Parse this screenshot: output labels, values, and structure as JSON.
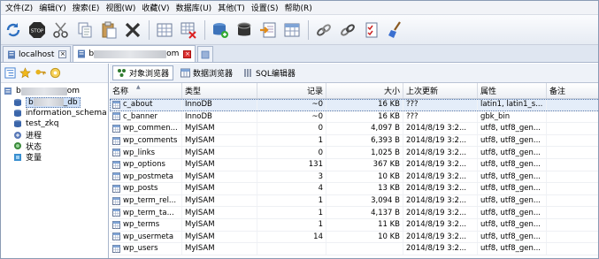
{
  "menu": [
    "文件(Z)",
    "编辑(Y)",
    "搜索(E)",
    "视图(W)",
    "收藏(V)",
    "数据库(U)",
    "其他(T)",
    "设置(S)",
    "帮助(R)"
  ],
  "toolbar_icons": [
    "refresh-icon",
    "stop-icon",
    "cut-icon",
    "copy-icon",
    "paste-icon",
    "delete-icon",
    "grid-icon",
    "grid-delete-icon",
    "database-add-icon",
    "database-icon",
    "import-icon",
    "table-icon",
    "link-icon",
    "link2-icon",
    "checklist-icon",
    "broom-icon"
  ],
  "conn_tabs": [
    {
      "label": "localhost",
      "active": false
    },
    {
      "label_prefix": "b",
      "label_suffix": "om",
      "active": true
    }
  ],
  "tree": [
    {
      "label_prefix": "b",
      "label_suffix": "om",
      "type": "server"
    },
    {
      "label_prefix": "b",
      "label_suffix": "_db",
      "type": "db",
      "selected": true
    },
    {
      "label": "information_schema",
      "type": "db"
    },
    {
      "label": "test_zkq",
      "type": "db"
    },
    {
      "label": "进程",
      "type": "process"
    },
    {
      "label": "状态",
      "type": "status"
    },
    {
      "label": "变量",
      "type": "variable"
    }
  ],
  "obj_tabs": [
    "对象浏览器",
    "数据浏览器",
    "SQL编辑器"
  ],
  "columns": [
    "名称",
    "类型",
    "记录",
    "大小",
    "上次更新",
    "属性",
    "备注"
  ],
  "rows": [
    [
      "c_about",
      "InnoDB",
      "~0",
      "16 KB",
      "???",
      "latin1, latin1_s...",
      ""
    ],
    [
      "c_banner",
      "InnoDB",
      "~0",
      "16 KB",
      "???",
      "gbk_bin",
      ""
    ],
    [
      "wp_commen...",
      "MyISAM",
      "0",
      "4,097 B",
      "2014/8/19 3:2...",
      "utf8, utf8_gen...",
      ""
    ],
    [
      "wp_comments",
      "MyISAM",
      "1",
      "6,393 B",
      "2014/8/19 3:2...",
      "utf8, utf8_gen...",
      ""
    ],
    [
      "wp_links",
      "MyISAM",
      "0",
      "1,025 B",
      "2014/8/19 3:2...",
      "utf8, utf8_gen...",
      ""
    ],
    [
      "wp_options",
      "MyISAM",
      "131",
      "367 KB",
      "2014/8/19 3:2...",
      "utf8, utf8_gen...",
      ""
    ],
    [
      "wp_postmeta",
      "MyISAM",
      "3",
      "10 KB",
      "2014/8/19 3:2...",
      "utf8, utf8_gen...",
      ""
    ],
    [
      "wp_posts",
      "MyISAM",
      "4",
      "13 KB",
      "2014/8/19 3:2...",
      "utf8, utf8_gen...",
      ""
    ],
    [
      "wp_term_rel...",
      "MyISAM",
      "1",
      "3,094 B",
      "2014/8/19 3:2...",
      "utf8, utf8_gen...",
      ""
    ],
    [
      "wp_term_ta...",
      "MyISAM",
      "1",
      "4,137 B",
      "2014/8/19 3:2...",
      "utf8, utf8_gen...",
      ""
    ],
    [
      "wp_terms",
      "MyISAM",
      "1",
      "11 KB",
      "2014/8/19 3:2...",
      "utf8, utf8_gen...",
      ""
    ],
    [
      "wp_usermeta",
      "MyISAM",
      "14",
      "10 KB",
      "2014/8/19 3:2...",
      "utf8, utf8_gen...",
      ""
    ],
    [
      "wp_users",
      "MyISAM",
      "",
      "",
      "2014/8/19 3:2...",
      "utf8, utf8_gen...",
      ""
    ]
  ]
}
